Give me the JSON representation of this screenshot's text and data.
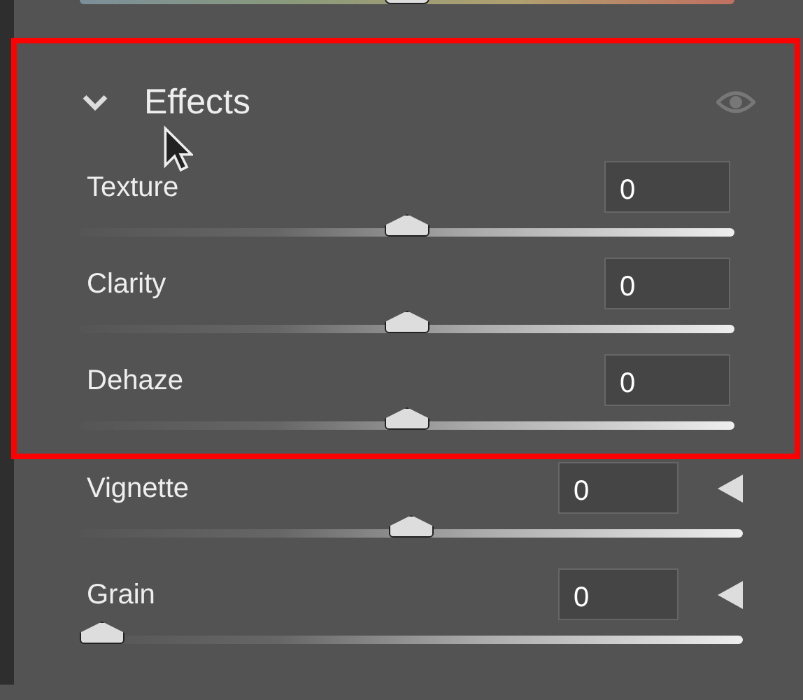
{
  "top_slider": {
    "level": 0.5
  },
  "section": {
    "title": "Effects",
    "expanded": true,
    "sliders": [
      {
        "label": "Texture",
        "value": "0",
        "level": 0.5
      },
      {
        "label": "Clarity",
        "value": "0",
        "level": 0.5
      },
      {
        "label": "Dehaze",
        "value": "0",
        "level": 0.5
      }
    ]
  },
  "sliders": [
    {
      "label": "Vignette",
      "value": "0",
      "level": 0.5,
      "kind": "arrow"
    },
    {
      "label": "Grain",
      "value": "0",
      "level": 0,
      "kind": "arrow"
    }
  ]
}
